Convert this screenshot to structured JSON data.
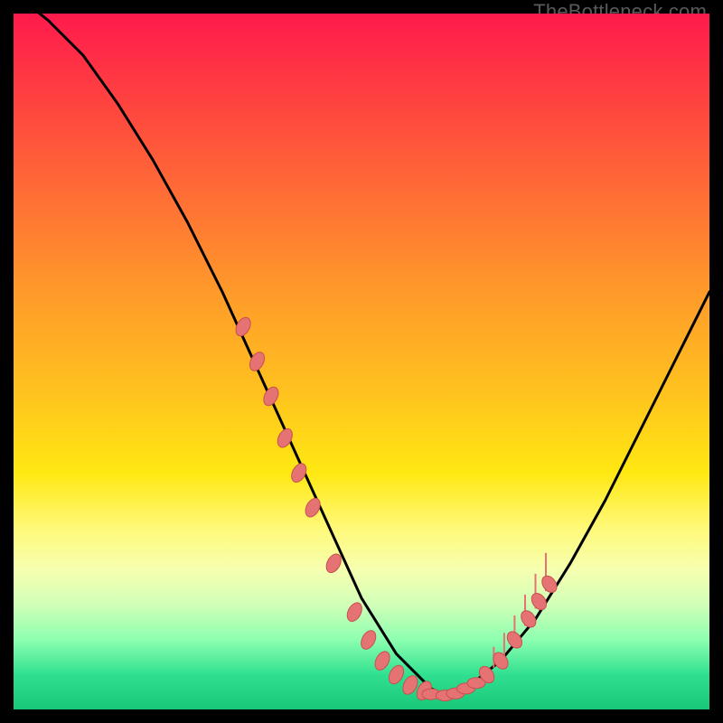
{
  "watermark": "TheBottleneck.com",
  "chart_data": {
    "type": "line",
    "title": "",
    "xlabel": "",
    "ylabel": "",
    "xlim": [
      0,
      100
    ],
    "ylim": [
      0,
      100
    ],
    "series": [
      {
        "name": "curve",
        "x": [
          0,
          5,
          10,
          15,
          20,
          25,
          30,
          35,
          40,
          45,
          50,
          55,
          60,
          62,
          65,
          70,
          75,
          80,
          85,
          90,
          95,
          100
        ],
        "y": [
          103,
          99,
          94,
          87,
          79,
          70,
          60,
          49,
          38,
          27,
          16,
          8,
          3,
          2,
          3,
          7,
          13,
          21,
          30,
          40,
          50,
          60
        ]
      }
    ],
    "markers_left": [
      {
        "x": 33,
        "y": 55
      },
      {
        "x": 35,
        "y": 50
      },
      {
        "x": 37,
        "y": 45
      },
      {
        "x": 39,
        "y": 39
      },
      {
        "x": 41,
        "y": 34
      },
      {
        "x": 43,
        "y": 29
      },
      {
        "x": 46,
        "y": 21
      },
      {
        "x": 49,
        "y": 14
      },
      {
        "x": 51,
        "y": 10
      },
      {
        "x": 53,
        "y": 7
      },
      {
        "x": 55,
        "y": 5
      },
      {
        "x": 57,
        "y": 3.5
      },
      {
        "x": 59,
        "y": 2.7
      }
    ],
    "markers_bottom": [
      {
        "x": 60,
        "y": 2.2
      },
      {
        "x": 62,
        "y": 2.0
      },
      {
        "x": 63.5,
        "y": 2.3
      },
      {
        "x": 65,
        "y": 3.0
      },
      {
        "x": 66.5,
        "y": 3.8
      }
    ],
    "markers_right": [
      {
        "x": 68,
        "y": 5
      },
      {
        "x": 70,
        "y": 7
      },
      {
        "x": 72,
        "y": 10
      },
      {
        "x": 74,
        "y": 13
      },
      {
        "x": 75.5,
        "y": 15.5
      },
      {
        "x": 77,
        "y": 18
      }
    ],
    "ticks_right": [
      {
        "x": 69,
        "y0": 6,
        "y1": 9
      },
      {
        "x": 70.5,
        "y0": 7.5,
        "y1": 11
      },
      {
        "x": 72,
        "y0": 9.5,
        "y1": 13.5
      },
      {
        "x": 73.5,
        "y0": 12,
        "y1": 16.5
      },
      {
        "x": 75,
        "y0": 14.5,
        "y1": 19.5
      },
      {
        "x": 76.5,
        "y0": 17,
        "y1": 22.5
      }
    ],
    "colors": {
      "curve": "#000000",
      "marker_fill": "#e57373",
      "marker_stroke": "#c94f4f",
      "tick": "#e57373"
    }
  }
}
